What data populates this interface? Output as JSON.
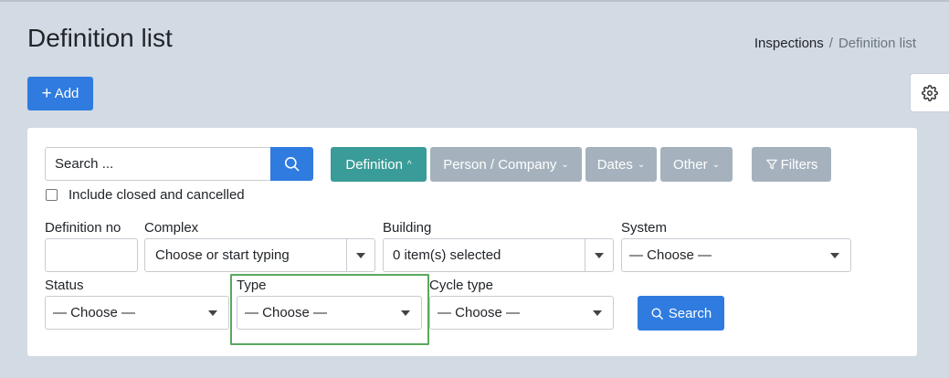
{
  "page": {
    "title": "Definition list",
    "breadcrumb": {
      "parent": "Inspections",
      "separator": "/",
      "current": "Definition list"
    }
  },
  "toolbar": {
    "add_label": "Add",
    "settings_icon": "gear-icon"
  },
  "filters": {
    "search_placeholder": "Search ...",
    "search_icon": "search-icon",
    "pills": [
      {
        "label": "Definition",
        "state": "active",
        "chevron": "up"
      },
      {
        "label": "Person / Company",
        "state": "inactive",
        "chevron": "down"
      },
      {
        "label": "Dates",
        "state": "inactive",
        "chevron": "down"
      },
      {
        "label": "Other",
        "state": "inactive",
        "chevron": "down"
      }
    ],
    "filters_button": "Filters",
    "include_closed_label": "Include closed and cancelled",
    "include_closed_checked": false
  },
  "fields": {
    "definition_no": {
      "label": "Definition no",
      "value": ""
    },
    "complex": {
      "label": "Complex",
      "value": "Choose or start typing"
    },
    "building": {
      "label": "Building",
      "value": "0 item(s) selected"
    },
    "system": {
      "label": "System",
      "value": "— Choose —"
    },
    "status": {
      "label": "Status",
      "value": "— Choose —"
    },
    "type": {
      "label": "Type",
      "value": "— Choose —"
    },
    "cycle_type": {
      "label": "Cycle type",
      "value": "— Choose —"
    }
  },
  "search_button": "Search",
  "colors": {
    "background": "#d2dae3",
    "primary": "#2f7be0",
    "active_pill": "#3a9c98",
    "inactive_pill": "#a5b2bd",
    "highlight": "#5aa85e"
  }
}
